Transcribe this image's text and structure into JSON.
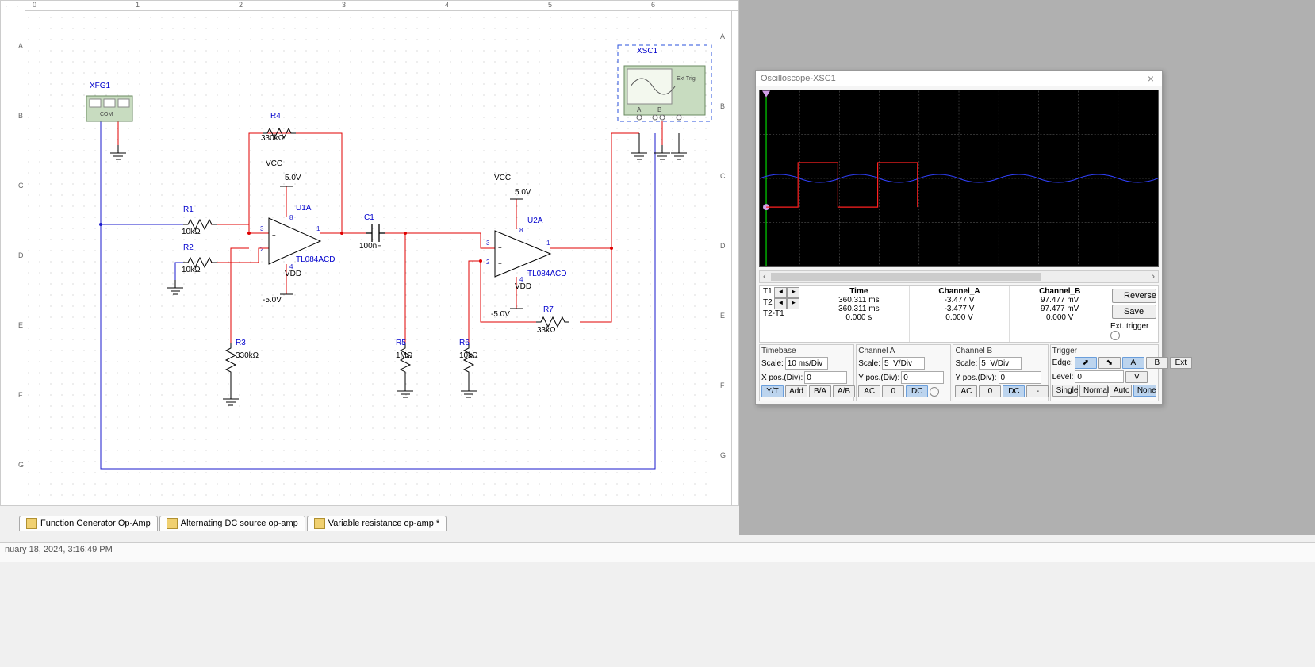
{
  "tabs": [
    {
      "label": "Function Generator Op-Amp"
    },
    {
      "label": "Alternating DC source op-amp"
    },
    {
      "label": "Variable resistance op-amp *"
    }
  ],
  "status_datetime": "nuary 18, 2024, 3:16:49 PM",
  "ruler_top": [
    "0",
    "1",
    "2",
    "3",
    "4",
    "5",
    "6"
  ],
  "ruler_left": [
    "A",
    "B",
    "C",
    "D",
    "E",
    "F",
    "G"
  ],
  "schematic": {
    "xfg1": {
      "name": "XFG1"
    },
    "xsc1": {
      "name": "XSC1",
      "ext": "Ext Trig",
      "chA": "A",
      "chB": "B"
    },
    "r1": {
      "name": "R1",
      "val": "10kΩ"
    },
    "r2": {
      "name": "R2",
      "val": "10kΩ"
    },
    "r3": {
      "name": "R3",
      "val": "330kΩ"
    },
    "r4": {
      "name": "R4",
      "val": "330kΩ"
    },
    "r5": {
      "name": "R5",
      "val": "1MΩ"
    },
    "r6": {
      "name": "R6",
      "val": "10kΩ"
    },
    "r7": {
      "name": "R7",
      "val": "33kΩ"
    },
    "c1": {
      "name": "C1",
      "val": "100nF"
    },
    "u1": {
      "name": "U1A",
      "model": "TL084ACD",
      "vcc": "VCC",
      "vdd": "VDD",
      "vccv": "5.0V",
      "vddv": "-5.0V",
      "pin_plus": "3",
      "pin_minus": "2",
      "pin_out": "1",
      "pin_vcc": "8",
      "pin_vdd": "4"
    },
    "u2": {
      "name": "U2A",
      "model": "TL084ACD",
      "vcc": "VCC",
      "vdd": "VDD",
      "vccv": "5.0V",
      "vddv": "-5.0V",
      "pin_plus": "3",
      "pin_minus": "2",
      "pin_out": "1",
      "pin_vcc": "8",
      "pin_vdd": "4"
    },
    "com": "COM"
  },
  "scope": {
    "title": "Oscilloscope-XSC1",
    "cursors": {
      "labels": {
        "t1": "T1",
        "t2": "T2",
        "diff": "T2-T1",
        "time": "Time",
        "cha": "Channel_A",
        "chb": "Channel_B"
      },
      "t1": {
        "time": "360.311 ms",
        "a": "-3.477 V",
        "b": "97.477 mV"
      },
      "t2": {
        "time": "360.311 ms",
        "a": "-3.477 V",
        "b": "97.477 mV"
      },
      "diff": {
        "time": "0.000 s",
        "a": "0.000 V",
        "b": "0.000 V"
      }
    },
    "reverse": "Reverse",
    "save": "Save",
    "ext_trigger": "Ext. trigger",
    "timebase": {
      "hdr": "Timebase",
      "scale_lbl": "Scale:",
      "scale": "10 ms/Div",
      "xpos_lbl": "X pos.(Div):",
      "xpos": "0",
      "buttons": {
        "yt": "Y/T",
        "add": "Add",
        "ba": "B/A",
        "ab": "A/B"
      }
    },
    "chA": {
      "hdr": "Channel A",
      "scale_lbl": "Scale:",
      "scale": "5  V/Div",
      "ypos_lbl": "Y pos.(Div):",
      "ypos": "0",
      "buttons": {
        "ac": "AC",
        "zero": "0",
        "dc": "DC"
      }
    },
    "chB": {
      "hdr": "Channel B",
      "scale_lbl": "Scale:",
      "scale": "5  V/Div",
      "ypos_lbl": "Y pos.(Div):",
      "ypos": "0",
      "buttons": {
        "ac": "AC",
        "zero": "0",
        "dc": "DC",
        "minus": "-"
      }
    },
    "trigger": {
      "hdr": "Trigger",
      "edge_lbl": "Edge:",
      "level_lbl": "Level:",
      "level": "0",
      "level_unit": "V",
      "edge_buttons": {
        "rise": "⬈",
        "fall": "⬊",
        "a": "A",
        "b": "B",
        "ext": "Ext"
      },
      "mode_buttons": {
        "single": "Single",
        "normal": "Normal",
        "auto": "Auto",
        "none": "None"
      }
    }
  }
}
